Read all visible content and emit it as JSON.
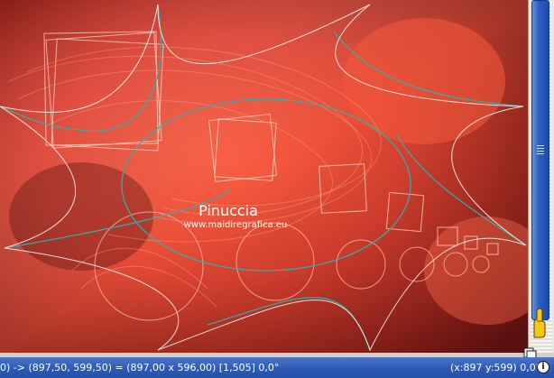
{
  "canvas": {
    "watermark_title": "Pinuccia",
    "watermark_url": "www.maidiregrafica.eu"
  },
  "statusbar": {
    "selection_info": "0) -> (897,50, 599,50) = (897,00 x 596,00) [1,505]  0,0°",
    "cursor_info": "(x:897 y:599) 0,0°",
    "info_icon": "i"
  },
  "colors": {
    "canvas_bright": "#f04a2f",
    "canvas_dark": "#5a1010",
    "selection_stroke": "#2fb0b0",
    "status_bg": "#2c5ab6",
    "scroll_thumb": "#2b5fc4"
  }
}
